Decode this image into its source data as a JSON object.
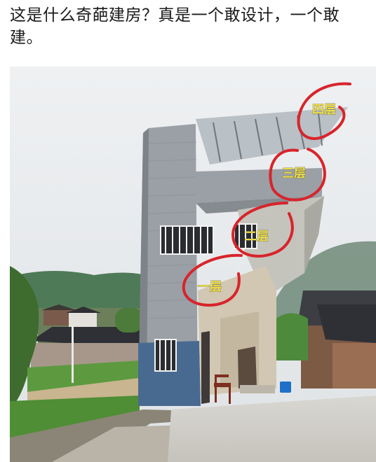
{
  "post": {
    "caption": "这是什么奇葩建房？真是一个敢设计，一个敢建。"
  },
  "photo": {
    "floor_labels": {
      "floor4": "四层",
      "floor3": "三层",
      "floor2": "二层",
      "floor1": "一层"
    }
  },
  "colors": {
    "annotation_circle": "#d8242b",
    "label_text": "#f4e34a",
    "sky": "#e9ecef"
  }
}
